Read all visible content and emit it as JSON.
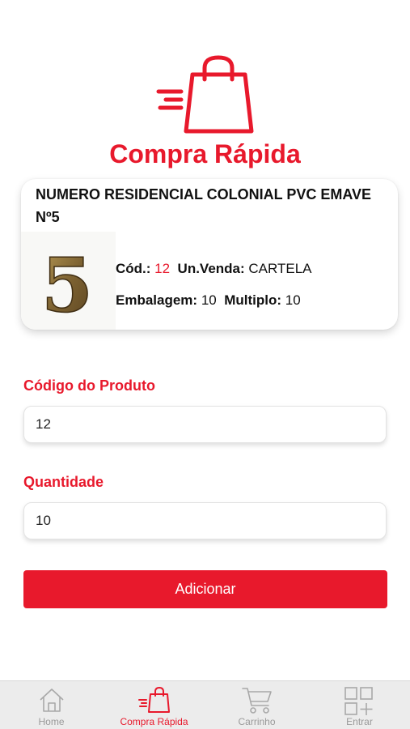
{
  "app": {
    "title": "Compra Rápida",
    "accent_color": "#e8192c"
  },
  "product": {
    "name": "NUMERO RESIDENCIAL COLONIAL PVC EMAVE Nº5",
    "image_digit": "5",
    "code_label": "Cód.:",
    "code_value": "12",
    "unit_label": "Un.Venda:",
    "unit_value": "CARTELA",
    "package_label": "Embalagem:",
    "package_value": "10",
    "multiple_label": "Multiplo:",
    "multiple_value": "10"
  },
  "form": {
    "code_label": "Código do Produto",
    "code_value": "12",
    "quantity_label": "Quantidade",
    "quantity_value": "10",
    "add_button_label": "Adicionar"
  },
  "tabs": [
    {
      "label": "Home",
      "icon": "home-icon",
      "active": false
    },
    {
      "label": "Compra Rápida",
      "icon": "shopping-bag-icon",
      "active": true
    },
    {
      "label": "Carrinho",
      "icon": "cart-icon",
      "active": false
    },
    {
      "label": "Entrar",
      "icon": "grid-add-icon",
      "active": false
    }
  ]
}
